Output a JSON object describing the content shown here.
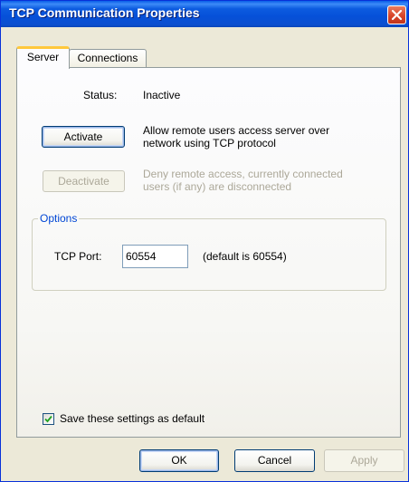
{
  "window": {
    "title": "TCP Communication Properties",
    "icons": {
      "close": "close-icon",
      "check": "checkmark-icon"
    }
  },
  "tabs": [
    {
      "label": "Server",
      "active": true
    },
    {
      "label": "Connections",
      "active": false
    }
  ],
  "server": {
    "status_label": "Status:",
    "status_value": "Inactive",
    "activate_label": "Activate",
    "activate_desc_line1": "Allow remote users access server over",
    "activate_desc_line2": "network using TCP protocol",
    "deactivate_label": "Deactivate",
    "deactivate_enabled": false,
    "deactivate_desc_line1": "Deny remote access, currently connected",
    "deactivate_desc_line2": "users (if any) are disconnected"
  },
  "options": {
    "legend": "Options",
    "port_label": "TCP Port:",
    "port_value": "60554",
    "port_hint": "(default is 60554)"
  },
  "save_default": {
    "label": "Save these settings as default",
    "checked": true
  },
  "buttons": {
    "ok": "OK",
    "cancel": "Cancel",
    "apply": "Apply",
    "apply_enabled": false
  },
  "colors": {
    "titlebar": "#0c5be0",
    "close": "#d8452a",
    "tab_highlight": "#ffc83c",
    "group_legend": "#0046d5"
  }
}
